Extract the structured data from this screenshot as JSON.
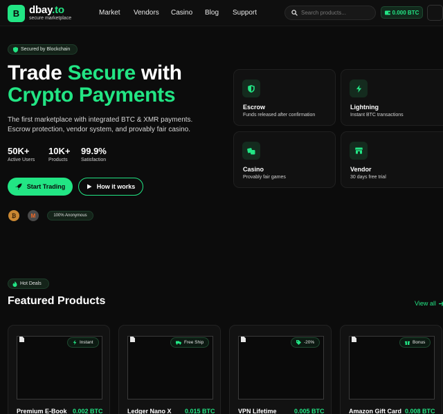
{
  "header": {
    "logo_letter": "B",
    "brand_name_main": "dbay",
    "brand_name_tld": ".to",
    "brand_tagline": "secure marketplace",
    "nav": [
      "Market",
      "Vendors",
      "Casino",
      "Blog",
      "Support"
    ],
    "search_placeholder": "Search products...",
    "wallet_balance": "0.000 BTC"
  },
  "hero": {
    "badge": "Secured by Blockchain",
    "title_line1_a": "Trade ",
    "title_line1_b": "Secure",
    "title_line1_c": " with",
    "title_line2": "Crypto Payments",
    "description": "The first marketplace with integrated BTC & XMR payments. Escrow protection, vendor system, and provably fair casino.",
    "stats": [
      {
        "value": "50K+",
        "label": "Active Users"
      },
      {
        "value": "10K+",
        "label": "Products"
      },
      {
        "value": "99.9%",
        "label": "Satisfaction"
      }
    ],
    "primary_button": "Start Trading",
    "secondary_button": "How it works",
    "coins": [
      "₿",
      "M"
    ],
    "anonymous_badge": "100% Anonymous"
  },
  "features": [
    {
      "title": "Escrow",
      "desc": "Funds released after confirmation",
      "icon": "shield-icon"
    },
    {
      "title": "Lightning",
      "desc": "Instant BTC transactions",
      "icon": "bolt-icon"
    },
    {
      "title": "Casino",
      "desc": "Provably fair games",
      "icon": "dice-icon"
    },
    {
      "title": "Vendor",
      "desc": "30 days free trial",
      "icon": "store-icon"
    }
  ],
  "featured": {
    "badge": "Hot Deals",
    "title": "Featured Products",
    "view_all": "View all",
    "products": [
      {
        "name": "Premium E-Book",
        "price": "0.002 BTC",
        "tag": "Instant",
        "tag_icon": "bolt-icon"
      },
      {
        "name": "Ledger Nano X",
        "price": "0.015 BTC",
        "tag": "Free Ship",
        "tag_icon": "truck-icon"
      },
      {
        "name": "VPN Lifetime",
        "price": "0.005 BTC",
        "tag": "-20%",
        "tag_icon": "tag-icon"
      },
      {
        "name": "Amazon Gift Card",
        "price": "0.008 BTC",
        "tag": "Bonus",
        "tag_icon": "gift-icon"
      }
    ]
  },
  "colors": {
    "accent": "#22e584",
    "background": "#0c0c0c",
    "card": "#111111"
  }
}
